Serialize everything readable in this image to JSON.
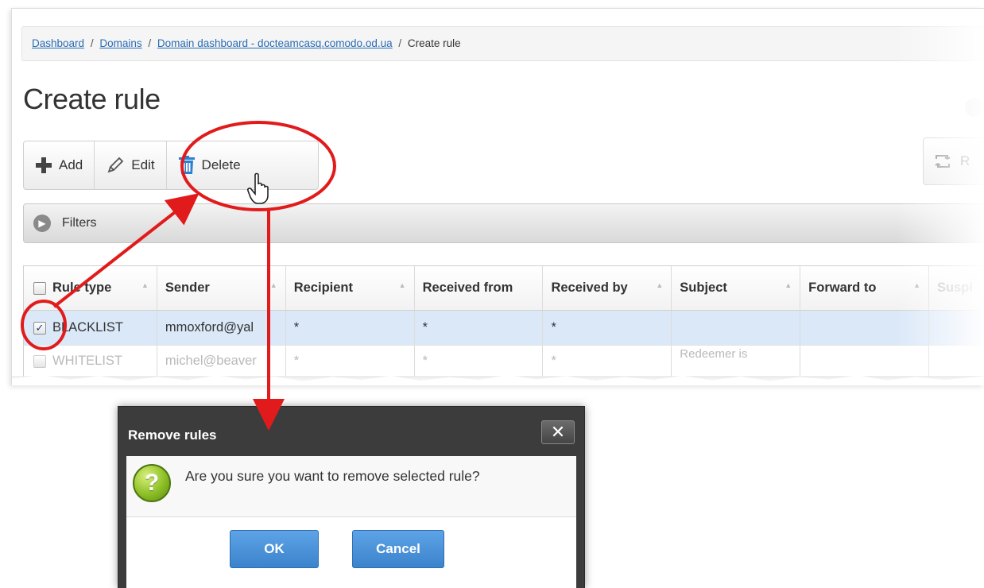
{
  "breadcrumb": {
    "items": [
      {
        "label": "Dashboard"
      },
      {
        "label": "Domains"
      },
      {
        "label": "Domain dashboard - docteamcasq.comodo.od.ua"
      }
    ],
    "separator": "/",
    "current": "Create rule"
  },
  "page": {
    "title": "Create rule"
  },
  "toolbar": {
    "add_label": "Add",
    "edit_label": "Edit",
    "delete_label": "Delete",
    "refresh_label": "R"
  },
  "filters": {
    "label": "Filters"
  },
  "grid": {
    "columns": [
      "Rule type",
      "Sender",
      "Recipient",
      "Received from",
      "Received by",
      "Subject",
      "Forward to",
      "Suspi"
    ],
    "rows": [
      {
        "checked": true,
        "cells": [
          "BLACKLIST",
          "mmoxford@yal",
          "*",
          "*",
          "*",
          "",
          "",
          ""
        ]
      },
      {
        "checked": false,
        "cells": [
          "WHITELIST",
          "michel@beaver",
          "*",
          "*",
          "*",
          "Redeemer is",
          "",
          ""
        ]
      }
    ]
  },
  "dialog": {
    "title": "Remove rules",
    "close_glyph": "✕",
    "message": "Are you sure you want to remove selected rule?",
    "icon_glyph": "?",
    "ok_label": "OK",
    "cancel_label": "Cancel"
  },
  "icons": {
    "add": "plus-icon",
    "edit": "pencil-icon",
    "delete": "trash-icon",
    "filters": "chevron-right-icon",
    "question": "question-icon",
    "cursor": "hand-cursor-icon"
  },
  "colors": {
    "link": "#2a6cb3",
    "delete_icon": "#2f7fd1",
    "selected_row": "#dbe8f8",
    "dialog_header": "#3c3c3c",
    "primary_button": "#4a90d9",
    "annotation": "#e11b1b"
  }
}
